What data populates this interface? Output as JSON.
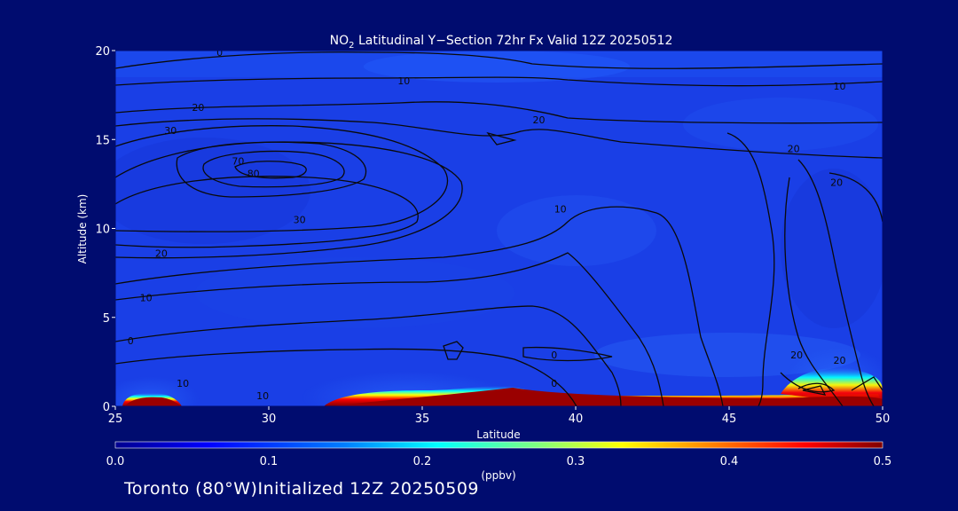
{
  "title_parts": {
    "pre": "NO",
    "sub": "2",
    "post": " Latitudinal Y−Section 72hr  Fx Valid 12Z 20250512"
  },
  "footer": "Toronto (80°W)Initialized 12Z 20250509",
  "colors": {
    "background": "#000c6f",
    "field_base": "#1a3fe6",
    "contour": "#0a0a0a"
  },
  "chart_data": {
    "type": "heatmap",
    "title": "NO₂ Latitudinal Y−Section 72hr  Fx Valid 12Z 20250512",
    "xlabel": "Latitude",
    "ylabel": "Altitude (km)",
    "xlim": [
      25,
      50
    ],
    "ylim": [
      0,
      20
    ],
    "x_ticks": [
      "25",
      "30",
      "35",
      "40",
      "45",
      "50"
    ],
    "y_ticks": [
      "0",
      "5",
      "10",
      "15",
      "20"
    ],
    "colorbar": {
      "label": "(ppbv)",
      "range": [
        0.0,
        0.5
      ],
      "ticks": [
        "0.0",
        "0.1",
        "0.2",
        "0.3",
        "0.4",
        "0.5"
      ],
      "stops": [
        "#00008f",
        "#0000ff",
        "#007fff",
        "#00ffff",
        "#7fff7f",
        "#ffff00",
        "#ff7f00",
        "#ff0000",
        "#7f0000"
      ]
    },
    "surface_plumes": [
      {
        "lat_from": 25.4,
        "lat_to": 27.5,
        "top_km": 0.45,
        "peak": 0.5
      },
      {
        "lat_from": 32.0,
        "lat_to": 38.3,
        "top_km": 0.85,
        "peak": 0.5
      },
      {
        "lat_from": 38.3,
        "lat_to": 50.0,
        "top_km": 0.4,
        "peak": 0.5
      },
      {
        "lat_from": 47.0,
        "lat_to": 50.0,
        "top_km": 1.4,
        "peak": 0.35
      }
    ],
    "contours": [
      {
        "label": "0",
        "lat": 28.4,
        "alt": 19.9
      },
      {
        "label": "10",
        "lat": 34.4,
        "alt": 18.3
      },
      {
        "label": "10",
        "lat": 48.6,
        "alt": 18.0
      },
      {
        "label": "20",
        "lat": 27.7,
        "alt": 16.8
      },
      {
        "label": "20",
        "lat": 38.8,
        "alt": 16.1
      },
      {
        "label": "30",
        "lat": 26.8,
        "alt": 15.5
      },
      {
        "label": "20",
        "lat": 47.1,
        "alt": 14.5
      },
      {
        "label": "70",
        "lat": 29.0,
        "alt": 13.8
      },
      {
        "label": "80",
        "lat": 29.5,
        "alt": 13.1
      },
      {
        "label": "20",
        "lat": 48.5,
        "alt": 12.6
      },
      {
        "label": "10",
        "lat": 39.5,
        "alt": 11.1
      },
      {
        "label": "30",
        "lat": 31.0,
        "alt": 10.5
      },
      {
        "label": "20",
        "lat": 26.5,
        "alt": 8.6
      },
      {
        "label": "10",
        "lat": 26.0,
        "alt": 6.1
      },
      {
        "label": "0",
        "lat": 25.5,
        "alt": 3.7
      },
      {
        "label": "0",
        "lat": 39.3,
        "alt": 2.9
      },
      {
        "label": "20",
        "lat": 47.2,
        "alt": 2.9
      },
      {
        "label": "20",
        "lat": 48.6,
        "alt": 2.6
      },
      {
        "label": "10",
        "lat": 27.2,
        "alt": 1.3
      },
      {
        "label": "10",
        "lat": 29.8,
        "alt": 0.6
      },
      {
        "label": "0",
        "lat": 39.3,
        "alt": 1.3
      }
    ]
  }
}
